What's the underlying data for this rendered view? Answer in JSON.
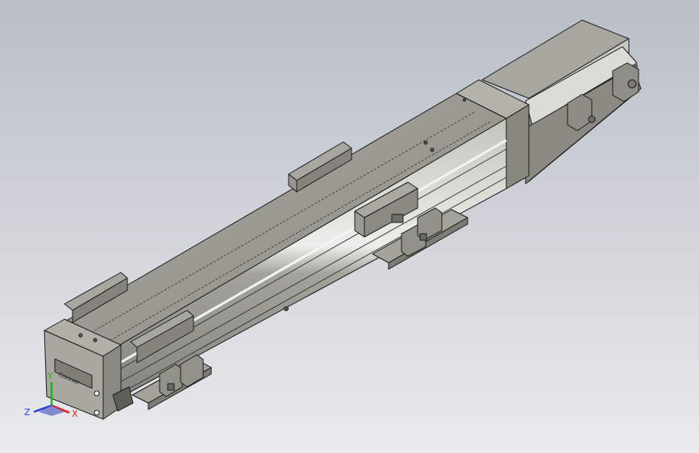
{
  "viewport": {
    "background_top": "#b9bec7",
    "background_bottom": "#e9eaed"
  },
  "model": {
    "body_color": "#9b9b93",
    "body_light": "#b0b0a8",
    "body_dark": "#6f6f69",
    "edge_color": "#1c1c1c",
    "rail_highlight": "#e2e2de",
    "label_text": "Coxxxer"
  },
  "triad": {
    "x_label": "X",
    "y_label": "Y",
    "z_label": "Z",
    "x_color": "#e11b1b",
    "y_color": "#1fb31f",
    "z_color": "#2a3fd6"
  }
}
